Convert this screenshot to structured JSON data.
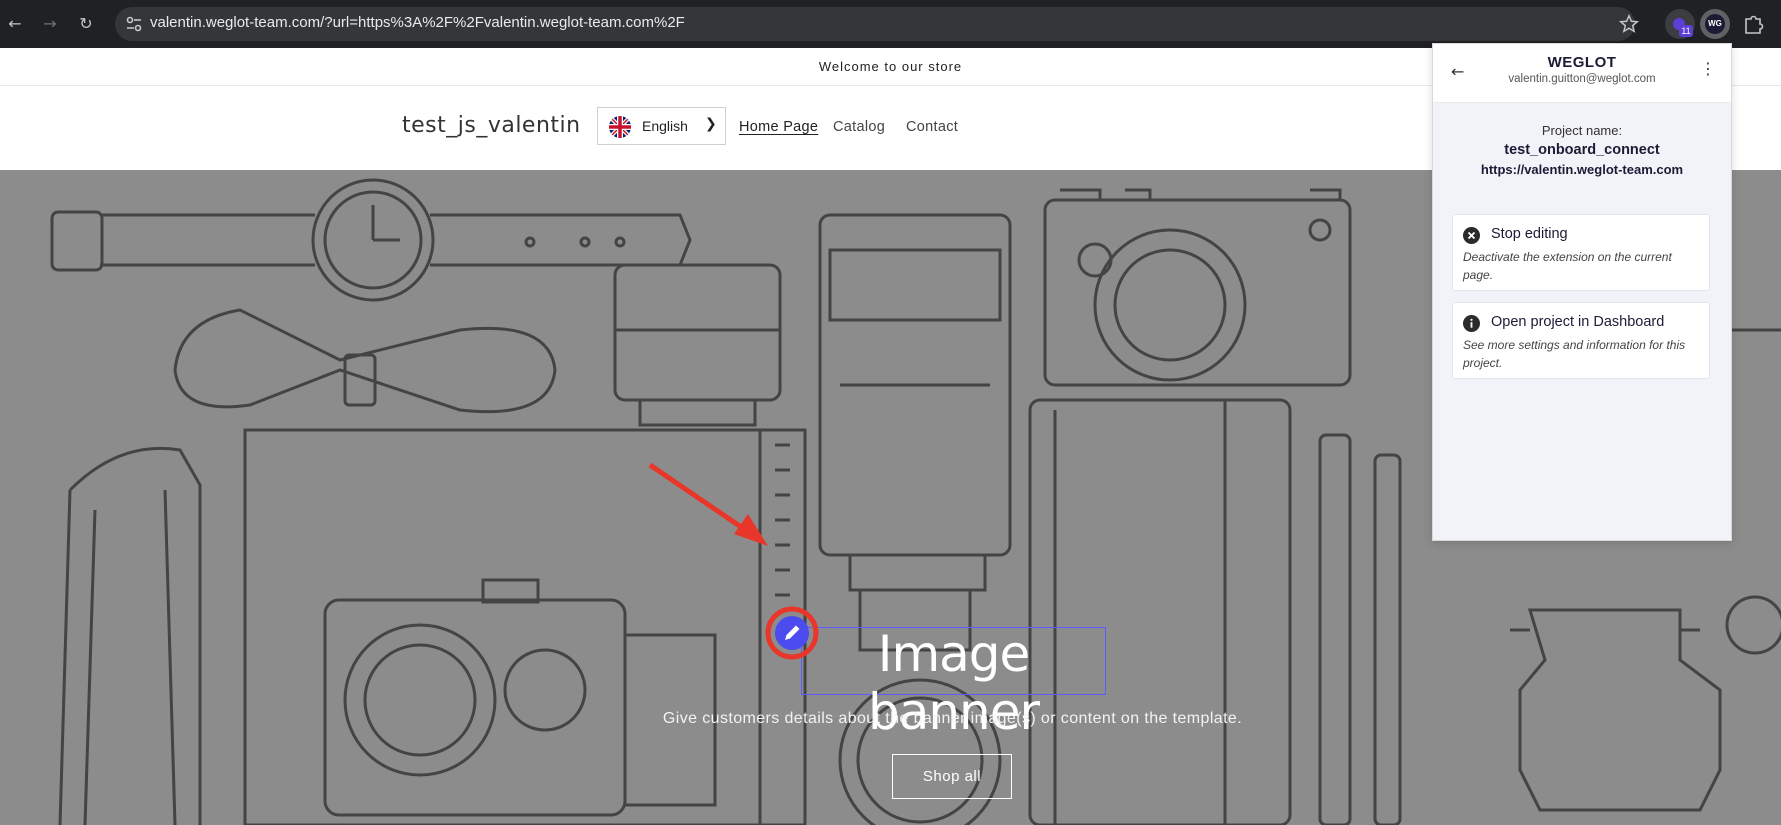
{
  "browser": {
    "url": "valentin.weglot-team.com/?url=https%3A%2F%2Fvalentin.weglot-team.com%2F",
    "back_icon": "arrow-left-icon",
    "forward_icon": "arrow-right-icon",
    "reload_icon": "reload-icon",
    "site_info_icon": "tune-icon",
    "bookmark_icon": "star-icon",
    "extensions": [
      {
        "name": "extension-badge-icon",
        "badge": "11"
      },
      {
        "name": "weglot-extension-icon",
        "label": "WG"
      },
      {
        "name": "puzzle-icon"
      }
    ]
  },
  "store": {
    "announcement": "Welcome to our store",
    "name": "test_js_valentin",
    "language": "English",
    "menu": [
      "Home Page",
      "Catalog",
      "Contact"
    ]
  },
  "banner": {
    "title": "Image banner",
    "subtitle": "Give customers details about the banner image(s) or content on the template.",
    "button": "Shop all",
    "edit_icon": "pencil-icon",
    "annotation_color": "#e8372a",
    "accent": "#4b4bef"
  },
  "weglot_popup": {
    "logo": "WEGLOT",
    "email": "valentin.guitton@weglot.com",
    "project_label": "Project name:",
    "project_name": "test_onboard_connect",
    "project_url": "https://valentin.weglot-team.com",
    "actions": [
      {
        "title": "Stop editing",
        "description": "Deactivate the extension on the current page.",
        "icon": "close-circle-icon"
      },
      {
        "title": "Open project in Dashboard",
        "description": "See more settings and information for this project.",
        "icon": "info-icon"
      }
    ]
  }
}
